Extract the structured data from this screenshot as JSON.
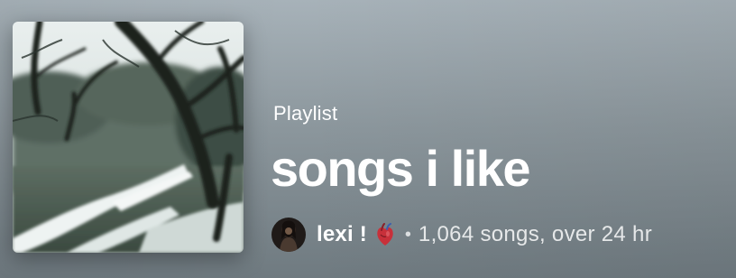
{
  "playlist": {
    "type_label": "Playlist",
    "title": "songs i like",
    "cover_icon": "forest-path-image",
    "owner": {
      "name": "lexi !",
      "avatar_icon": "user-avatar",
      "emoji_icon": "anatomical-heart-icon"
    },
    "separator": "•",
    "stats": "1,064 songs, over 24 hr"
  },
  "colors": {
    "background_top": "#a7b2b9",
    "background_bottom": "#6f7a80",
    "text": "#ffffff"
  }
}
